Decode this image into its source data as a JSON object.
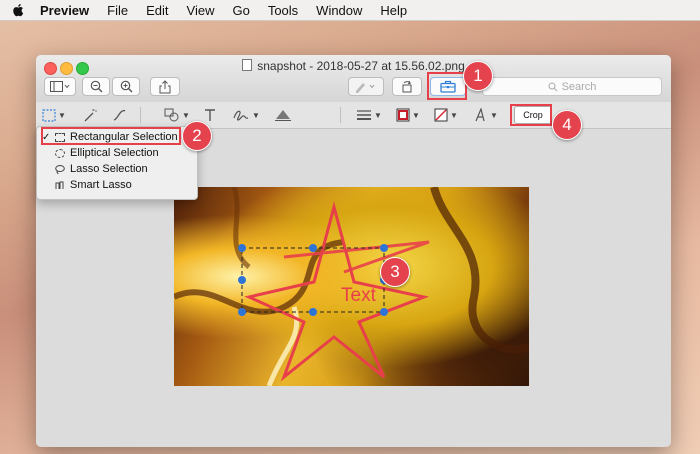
{
  "menubar": {
    "app_name": "Preview",
    "items": [
      "File",
      "Edit",
      "View",
      "Go",
      "Tools",
      "Window",
      "Help"
    ]
  },
  "window": {
    "title": "snapshot -  2018-05-27 at 15.56.02.png"
  },
  "toolbar": {
    "search_placeholder": "Search"
  },
  "markup": {
    "crop_label": "Crop"
  },
  "selection_menu": {
    "items": [
      "Rectangular Selection",
      "Elliptical Selection",
      "Lasso Selection",
      "Smart Lasso"
    ],
    "checked_index": 0
  },
  "image": {
    "annotation_text": "Text"
  },
  "callouts": [
    "1",
    "2",
    "3",
    "4"
  ],
  "colors": {
    "callout": "#e4424d",
    "annotation": "#e8404a",
    "selection_handle": "#2e74d6",
    "toolbox_blue": "#2f7fd8"
  }
}
